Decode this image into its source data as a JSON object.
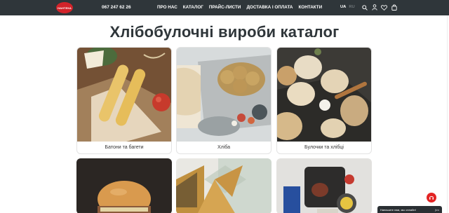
{
  "header": {
    "logo_text": "НАНТЕКА",
    "phone": "067 247 62 26",
    "nav": [
      "ПРО НАС",
      "КАТАЛОГ",
      "ПРАЙС-ЛИСТИ",
      "ДОСТАВКА І ОПЛАТА",
      "КОНТАКТИ"
    ],
    "lang_active": "UA",
    "lang_inactive": "RU",
    "icons": [
      "search-icon",
      "user-icon",
      "heart-icon",
      "cart-icon"
    ]
  },
  "main": {
    "title": "Хлібобулочні вироби каталог",
    "categories": [
      {
        "label": "Батони та багети"
      },
      {
        "label": "Хліба"
      },
      {
        "label": "Булочки та хлібці"
      }
    ]
  },
  "chat": {
    "text": "Напишите нам, мы онлайн!",
    "tag": "jivo"
  },
  "colors": {
    "header_bg": "#2f363a",
    "brand_red": "#d2232a",
    "title": "#2f363a"
  }
}
